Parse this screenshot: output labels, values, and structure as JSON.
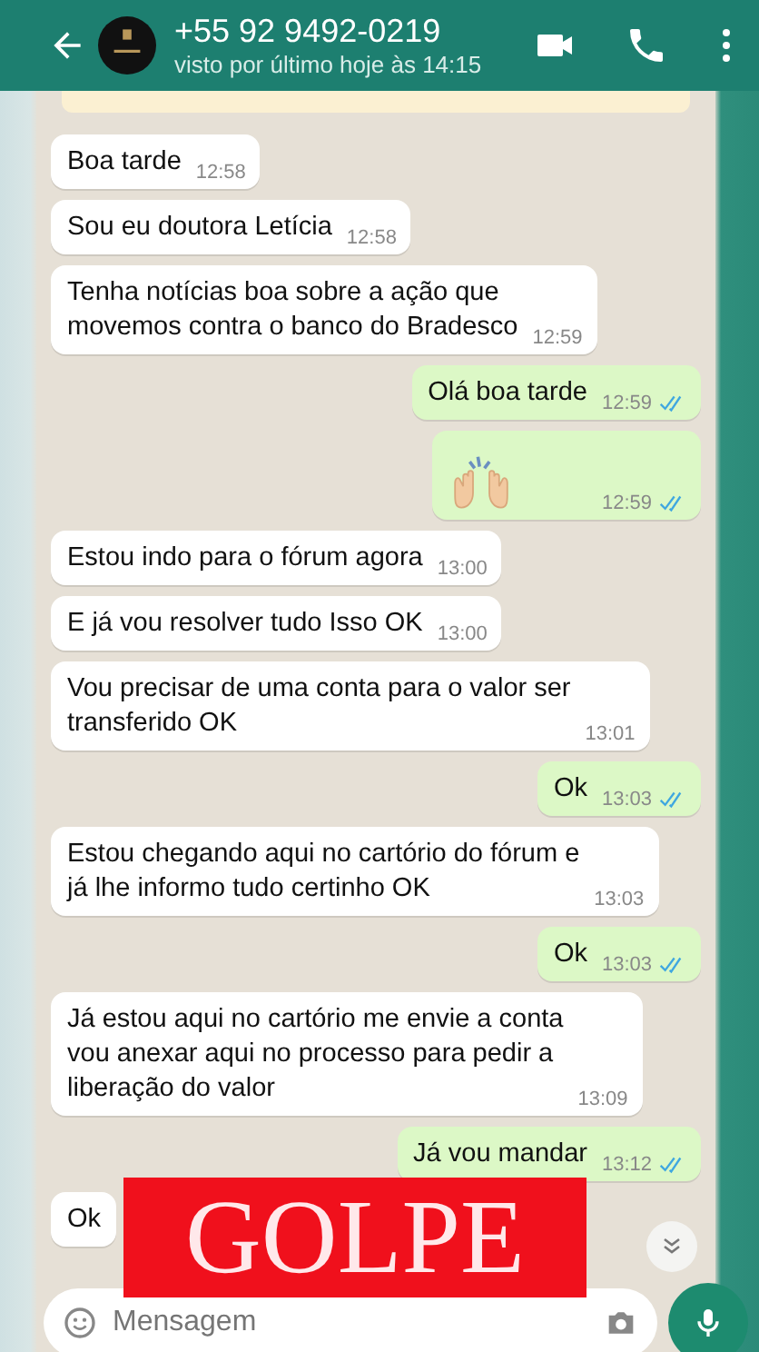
{
  "header": {
    "contact": "+55 92 9492-0219",
    "status": "visto por último hoje às 14:15"
  },
  "messages": [
    {
      "outgoing": false,
      "kind": "text",
      "text": "Boa tarde",
      "time": "12:58"
    },
    {
      "outgoing": false,
      "kind": "text",
      "text": "Sou eu doutora Letícia",
      "time": "12:58"
    },
    {
      "outgoing": false,
      "kind": "text",
      "text": "Tenha notícias boa sobre a ação que\nmovemos contra o banco do Bradesco",
      "time": "12:59"
    },
    {
      "outgoing": true,
      "kind": "text",
      "text": "Olá boa tarde",
      "time": "12:59",
      "read": true
    },
    {
      "outgoing": true,
      "kind": "emoji",
      "time": "12:59",
      "read": true
    },
    {
      "outgoing": false,
      "kind": "text",
      "text": "Estou indo para o fórum agora",
      "time": "13:00"
    },
    {
      "outgoing": false,
      "kind": "text",
      "text": "E já vou resolver tudo Isso OK",
      "time": "13:00"
    },
    {
      "outgoing": false,
      "kind": "text",
      "text": "Vou precisar de uma conta para o valor ser\ntransferido OK",
      "time": "13:01"
    },
    {
      "outgoing": true,
      "kind": "text",
      "text": "Ok",
      "time": "13:03",
      "read": true
    },
    {
      "outgoing": false,
      "kind": "text",
      "text": "Estou chegando aqui no cartório do fórum e\njá lhe informo tudo certinho OK",
      "time": "13:03"
    },
    {
      "outgoing": true,
      "kind": "text",
      "text": "Ok",
      "time": "13:03",
      "read": true
    },
    {
      "outgoing": false,
      "kind": "text",
      "text": "Já estou aqui no cartório me envie a conta\nvou anexar aqui no processo para pedir a\nliberação do valor",
      "time": "13:09"
    },
    {
      "outgoing": true,
      "kind": "text",
      "text": "Já vou mandar",
      "time": "13:12",
      "read": true
    },
    {
      "outgoing": false,
      "kind": "text",
      "text": "Ok"
    }
  ],
  "composer": {
    "placeholder": "Mensagem"
  },
  "overlay": {
    "label": "GOLPE"
  }
}
